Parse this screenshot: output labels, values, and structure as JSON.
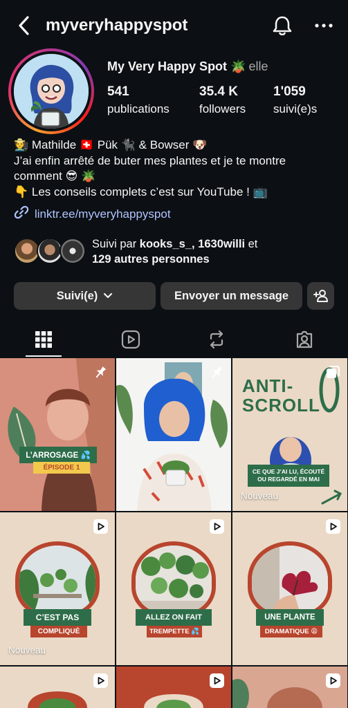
{
  "header": {
    "username": "myveryhappyspot",
    "back_icon": "chevron-left-icon",
    "notifications_icon": "bell-icon",
    "more_icon": "ellipsis-icon"
  },
  "profile": {
    "display_name": "My Very Happy Spot 🪴",
    "pronoun": "elle",
    "stats": [
      {
        "value": "541",
        "label": "publications"
      },
      {
        "value": "35.4 K",
        "label": "followers"
      },
      {
        "value": "1'059",
        "label": "suivi(e)s"
      }
    ],
    "bio_lines": [
      "🧑‍🌾 Mathilde 🇨🇭 Pük 🐈‍⬛ & Bowser 🐶",
      "J’ai enfin arrêté de buter mes plantes et je te montre",
      "comment 😎 🪴",
      "👇 Les conseils complets c’est sur YouTube ! 📺"
    ],
    "link": "linktr.ee/myveryhappyspot",
    "followed_by_prefix": "Suivi par ",
    "followed_by_names": "kooks_s_, 1630willi",
    "followed_by_mid": " et",
    "followed_by_others": "129 autres personnes"
  },
  "actions": {
    "follow_label": "Suivi(e)",
    "message_label": "Envoyer un message"
  },
  "tabs": [
    {
      "name": "grid-icon",
      "active": true
    },
    {
      "name": "reels-icon",
      "active": false
    },
    {
      "name": "reposts-icon",
      "active": false
    },
    {
      "name": "tagged-icon",
      "active": false
    }
  ],
  "posts": [
    {
      "title": "L’ARROSAGE 💦",
      "subtitle": "ÉPISODE 1",
      "badge": "pin-icon",
      "label": ""
    },
    {
      "title": "",
      "subtitle": "",
      "badge": "pin-icon",
      "label": ""
    },
    {
      "title": "ANTI-SCROLL",
      "subtitle": "CE QUE J’AI LU, ÉCOUTÉ OU REGARDÉ EN MAI",
      "badge": "carousel-icon",
      "label": "Nouveau"
    },
    {
      "title": "C’EST PAS",
      "subtitle": "COMPLIQUÉ",
      "badge": "reel-icon",
      "label": "Nouveau"
    },
    {
      "title": "ALLEZ ON FAIT",
      "subtitle": "TREMPETTE 💦",
      "badge": "reel-icon",
      "label": ""
    },
    {
      "title": "UNE PLANTE",
      "subtitle": "DRAMATIQUE 😩",
      "badge": "reel-icon",
      "label": ""
    }
  ],
  "colors": {
    "background": "#0c1014",
    "button": "#363636",
    "link": "#b0c4ff",
    "post_green": "#2e6d4a",
    "post_red": "#b8452e",
    "post_beige": "#ead9c6"
  }
}
